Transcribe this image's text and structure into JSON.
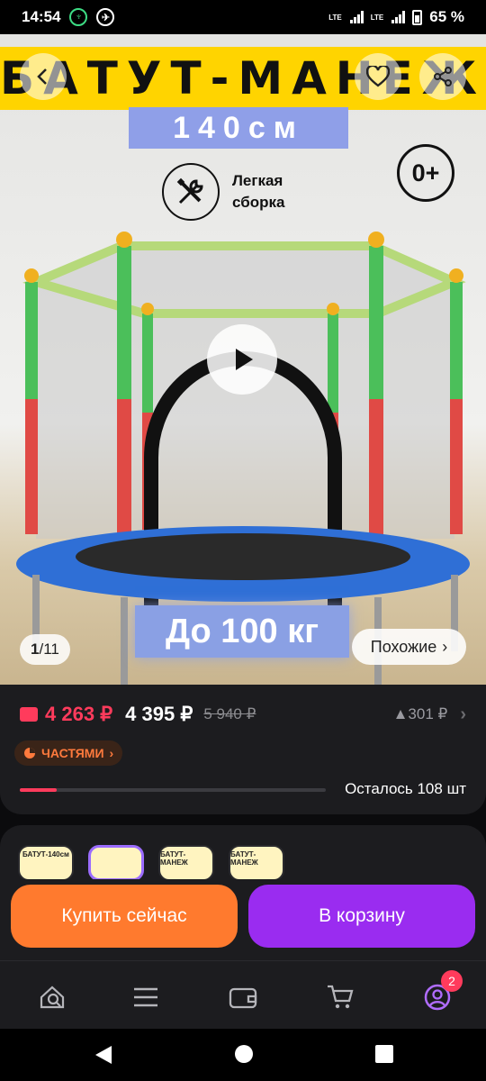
{
  "status_bar": {
    "time": "14:54",
    "battery": "65 %",
    "network_1": "LTE",
    "network_2": "LTE"
  },
  "gallery": {
    "banner_text": "БАТУТ-МАНЕЖ",
    "size_text": "140см",
    "assembly_text": "Легкая сборка",
    "age_text": "0+",
    "weight_text": "До 100 кг",
    "counter_current": "1",
    "counter_total": "/11",
    "similar_label": "Похожие",
    "similar_chevron": "›"
  },
  "price": {
    "card_price": "4 263 ₽",
    "main_price": "4 395 ₽",
    "old_price": "5 940 ₽",
    "increase": "▲301 ₽",
    "installment_label": "ЧАСТЯМИ",
    "installment_chevron": "›",
    "stock_text": "Осталось 108 шт",
    "stock_level": 0.12
  },
  "variants": [
    {
      "label": "БАТУТ-140см"
    },
    {
      "label": ""
    },
    {
      "label": "БАТУТ-МАНЕЖ"
    },
    {
      "label": "БАТУТ-МАНЕЖ"
    }
  ],
  "actions": {
    "buy_now": "Купить сейчас",
    "add_to_cart": "В корзину"
  },
  "tab_bar": {
    "items": [
      "search-icon",
      "menu-icon",
      "wallet-icon",
      "cart-icon",
      "profile-icon"
    ],
    "profile_badge": "2"
  },
  "colors": {
    "accent_red": "#ff3b5c",
    "buy_orange": "#ff7a2e",
    "cart_purple": "#9a2cf0",
    "banner_yellow": "#ffd400"
  }
}
